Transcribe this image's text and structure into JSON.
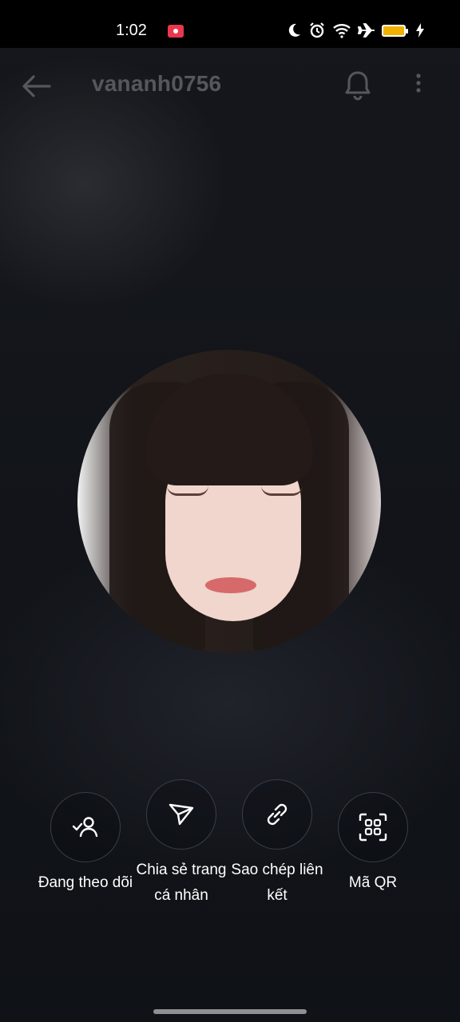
{
  "status_bar": {
    "time": "1:02",
    "icons": [
      "screen-record-icon",
      "moon-icon",
      "alarm-icon",
      "wifi-icon",
      "airplane-icon",
      "battery-icon",
      "charging-icon"
    ],
    "battery_color": "#f1b100"
  },
  "header": {
    "title": "vananh0756",
    "back_icon": "arrow-left-icon",
    "bell_icon": "bell-icon",
    "more_icon": "more-vertical-icon"
  },
  "avatar": {
    "description_icon": "profile-photo"
  },
  "actions": [
    {
      "label": "Đang theo dõi",
      "icon": "following-user-check-icon"
    },
    {
      "label": "Chia sẻ trang cá nhân",
      "label_lines": [
        "Chia sẻ trang",
        "cá nhân"
      ],
      "icon": "send-share-icon"
    },
    {
      "label": "Sao chép liên kết",
      "label_lines": [
        "Sao chép liên",
        "kết"
      ],
      "icon": "link-icon"
    },
    {
      "label": "Mã QR",
      "icon": "qr-code-icon"
    }
  ],
  "colors": {
    "background": "#13161b",
    "title": "#55575d",
    "action_border": "#3b3e46"
  }
}
